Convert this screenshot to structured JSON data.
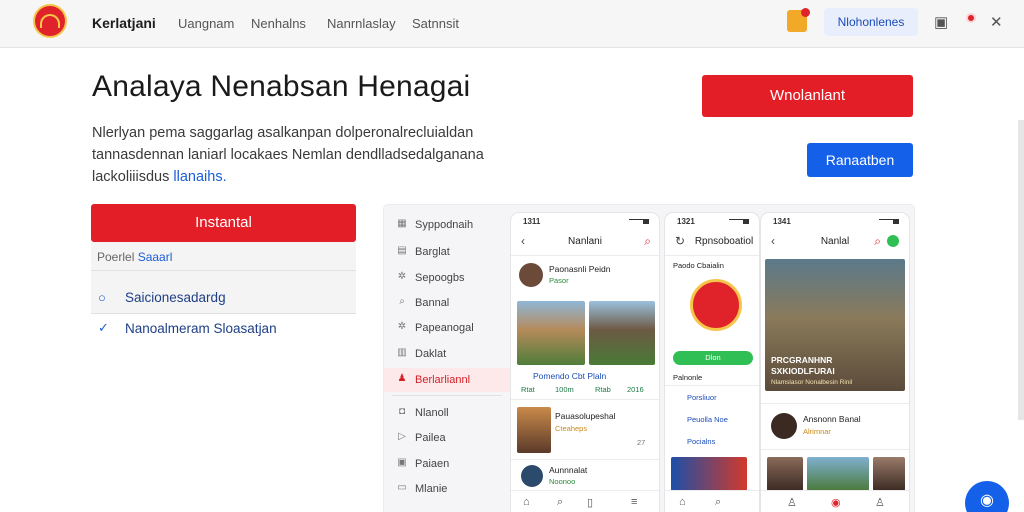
{
  "brand": "Kerlatjani",
  "nav": {
    "links": [
      "Uangnam",
      "Nenhalns",
      "Nanrnlaslay",
      "Satnnsit"
    ],
    "pill": "Nlohonlenes"
  },
  "hero": {
    "title": "Analaya Nenabsan Henagai",
    "desc_line1": "Nlerlyan pema saggarlag asalkanpan dolperonalrecluialdan",
    "desc_line2": "tannasdennan laniarl locakaes Nemlan dendlladsedalganana",
    "desc_line3": "lackoliiisdus",
    "desc_link": "llanaihs.",
    "btn_top": "Wnolanlant",
    "btn_blue": "Ranaatben"
  },
  "left": {
    "btn": "Instantal",
    "card_head": "Poerlel",
    "card_head_accent": "Saaarl",
    "opt1": "Saicionesadardg",
    "opt2": "Nanoalmeram Sloasatjan"
  },
  "sidebar": [
    {
      "icon": "grid",
      "label": "Syppodnaih"
    },
    {
      "icon": "list",
      "label": "Barglat"
    },
    {
      "icon": "gear",
      "label": "Sepoogbs"
    },
    {
      "icon": "search",
      "label": "Bannal"
    },
    {
      "icon": "gear",
      "label": "Papeanogal"
    },
    {
      "icon": "chart",
      "label": "Daklat"
    },
    {
      "icon": "person",
      "label": "Berlarliannl"
    },
    {
      "icon": "bell",
      "label": "Nlanoll"
    },
    {
      "icon": "play",
      "label": "Pailea"
    },
    {
      "icon": "image",
      "label": "Paiaen"
    },
    {
      "icon": "monitor",
      "label": "Mlanie"
    }
  ],
  "phone1": {
    "time": "1311",
    "title": "Nanlani",
    "post_name": "Paonasnli Peidn",
    "post_sub": "Pasor",
    "caption": "Pomendo Cbt Plaln",
    "stats": [
      "Rtat",
      "100m",
      "Rtab",
      "2016"
    ],
    "item2_title": "Pauasolupeshal",
    "item2_sub": "Cteaheps",
    "item2_num": "27",
    "item3_title": "Aunnnalat",
    "item3_sub": "Noonoo"
  },
  "phone2": {
    "time": "1321",
    "title": "Rpnsoboatiol",
    "header": "Paodo Cbaialin",
    "btn": "Dlon",
    "label": "Palnonle",
    "rows": [
      "Porsliuor",
      "Peuolla Noe",
      "Pocialns"
    ]
  },
  "phone3": {
    "time": "1341",
    "title": "Nanlal",
    "overlay_l1": "PRCGRANHNR",
    "overlay_l2": "SXKIODLFURAI",
    "overlay_caption": "Nlamslasor Nonalbesin Rinil",
    "item_title": "Ansnonn Banal",
    "item_sub": "Alrimnar"
  },
  "colors": {
    "accent_red": "#e41e26",
    "accent_blue": "#1460e8"
  }
}
